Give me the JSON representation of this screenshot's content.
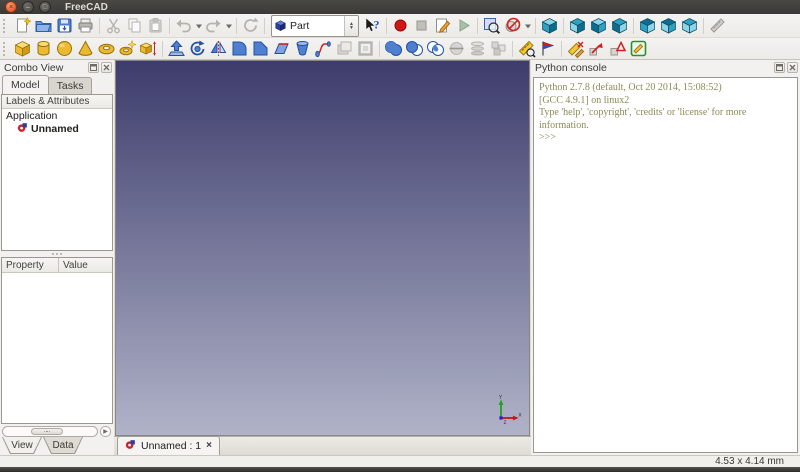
{
  "window": {
    "title": "FreeCAD"
  },
  "titlebar": {
    "buttons": [
      "close",
      "minimize",
      "maximize"
    ]
  },
  "toolbars": {
    "workbench_selector": {
      "value": "Part",
      "icon": "workbench-cube-icon"
    },
    "row1": [
      {
        "name": "new-document",
        "icon": "new-document-icon"
      },
      {
        "name": "open-document",
        "icon": "open-folder-icon"
      },
      {
        "name": "save-document",
        "icon": "save-icon"
      },
      {
        "name": "print",
        "icon": "print-icon"
      },
      {
        "separator": true
      },
      {
        "name": "cut",
        "icon": "cut-icon",
        "disabled": true
      },
      {
        "name": "copy",
        "icon": "copy-icon",
        "disabled": true
      },
      {
        "name": "paste",
        "icon": "paste-icon",
        "disabled": true
      },
      {
        "separator": true
      },
      {
        "name": "undo",
        "icon": "undo-icon",
        "disabled": true,
        "dropdown": true
      },
      {
        "name": "redo",
        "icon": "redo-icon",
        "disabled": true,
        "dropdown": true
      },
      {
        "separator": true
      },
      {
        "name": "refresh",
        "icon": "refresh-icon",
        "disabled": true
      },
      {
        "separator": true
      },
      {
        "workbench_selector": true
      },
      {
        "name": "whats-this",
        "icon": "whats-this-icon"
      },
      {
        "separator": true
      },
      {
        "name": "macro-record",
        "icon": "record-icon"
      },
      {
        "name": "macro-stop",
        "icon": "stop-icon",
        "disabled": true
      },
      {
        "name": "macro-edit",
        "icon": "edit-macro-icon"
      },
      {
        "name": "macro-play",
        "icon": "play-icon",
        "disabled": true
      },
      {
        "separator": true
      },
      {
        "name": "fit-all",
        "icon": "fit-all-icon"
      },
      {
        "name": "draw-style",
        "icon": "draw-style-icon",
        "dropdown": true
      },
      {
        "separator": true
      },
      {
        "name": "view-isometric",
        "icon": "cube-isometric-icon"
      },
      {
        "separator": true
      },
      {
        "name": "view-front",
        "icon": "cube-front-icon"
      },
      {
        "name": "view-top",
        "icon": "cube-top-icon"
      },
      {
        "name": "view-right",
        "icon": "cube-right-icon"
      },
      {
        "separator": true
      },
      {
        "name": "view-rear",
        "icon": "cube-rear-icon"
      },
      {
        "name": "view-bottom",
        "icon": "cube-bottom-icon"
      },
      {
        "name": "view-left",
        "icon": "cube-left-icon"
      },
      {
        "separator": true
      },
      {
        "name": "measure-distance",
        "icon": "measure-distance-icon",
        "disabled": true
      }
    ],
    "row2": [
      {
        "name": "part-box",
        "icon": "box-icon"
      },
      {
        "name": "part-cylinder",
        "icon": "cylinder-icon"
      },
      {
        "name": "part-sphere",
        "icon": "sphere-icon"
      },
      {
        "name": "part-cone",
        "icon": "cone-icon"
      },
      {
        "name": "part-torus",
        "icon": "torus-icon"
      },
      {
        "name": "part-create-primitives",
        "icon": "create-primitives-icon"
      },
      {
        "name": "part-shape-builder",
        "icon": "shape-builder-icon"
      },
      {
        "separator": true
      },
      {
        "name": "part-extrude",
        "icon": "extrude-icon"
      },
      {
        "name": "part-revolve",
        "icon": "revolve-icon"
      },
      {
        "name": "part-mirror",
        "icon": "mirror-icon"
      },
      {
        "name": "part-fillet",
        "icon": "fillet-icon"
      },
      {
        "name": "part-chamfer",
        "icon": "chamfer-icon"
      },
      {
        "name": "part-ruled-surface",
        "icon": "ruled-surface-icon"
      },
      {
        "name": "part-loft",
        "icon": "loft-icon"
      },
      {
        "name": "part-sweep",
        "icon": "sweep-icon"
      },
      {
        "name": "part-offset",
        "icon": "offset-icon",
        "disabled": true
      },
      {
        "name": "part-thickness",
        "icon": "thickness-icon",
        "disabled": true
      },
      {
        "separator": true
      },
      {
        "name": "part-boolean-union",
        "icon": "boolean-union-icon"
      },
      {
        "name": "part-boolean-cut",
        "icon": "boolean-cut-icon"
      },
      {
        "name": "part-boolean-common",
        "icon": "boolean-common-icon"
      },
      {
        "name": "part-section",
        "icon": "section-icon",
        "disabled": true
      },
      {
        "name": "part-cross-sections",
        "icon": "cross-sections-icon",
        "disabled": true
      },
      {
        "name": "part-compound",
        "icon": "compound-icon",
        "disabled": true
      },
      {
        "separator": true
      },
      {
        "name": "measure-linear",
        "icon": "measure-linear-icon"
      },
      {
        "name": "measure-angular",
        "icon": "measure-angular-icon"
      },
      {
        "separator": true
      },
      {
        "name": "measure-clear-all",
        "icon": "measure-clear-icon"
      },
      {
        "name": "measure-toggle-3d",
        "icon": "measure-toggle-3d-icon"
      },
      {
        "name": "measure-toggle-delta",
        "icon": "measure-toggle-delta-icon"
      },
      {
        "name": "measure-toggle-all",
        "icon": "measure-toggle-all-icon"
      }
    ]
  },
  "combo_view": {
    "title": "Combo View",
    "tabs": [
      {
        "label": "Model",
        "active": true
      },
      {
        "label": "Tasks",
        "active": false
      }
    ],
    "tree_header": "Labels & Attributes",
    "tree": {
      "root_label": "Application",
      "document_label": "Unnamed",
      "document_icon": "freecad-document-icon"
    },
    "property_table": {
      "columns": [
        "Property",
        "Value"
      ],
      "rows": []
    },
    "bottom_tabs": [
      {
        "label": "View",
        "active": true
      },
      {
        "label": "Data",
        "active": false
      }
    ]
  },
  "viewport": {
    "gradient_top": "#3d3c6c",
    "gradient_bottom": "#b0b3c8",
    "axis_labels": {
      "x": "x",
      "y": "Y",
      "z": "z"
    },
    "axis_colors": {
      "x": "#c41616",
      "y": "#1fa31f",
      "z": "#2222cc"
    }
  },
  "mdi": {
    "tabs": [
      {
        "label": "Unnamed : 1",
        "active": true,
        "closable": true
      }
    ]
  },
  "python_console": {
    "title": "Python console",
    "text_color": "#8b8b57",
    "lines": [
      "Python 2.7.8 (default, Oct 20 2014, 15:08:52)",
      "[GCC 4.9.1] on linux2",
      "Type 'help', 'copyright', 'credits' or 'license' for more information.",
      ">>>"
    ]
  },
  "status_bar": {
    "dimensions": "4.53 x 4.14 mm"
  }
}
